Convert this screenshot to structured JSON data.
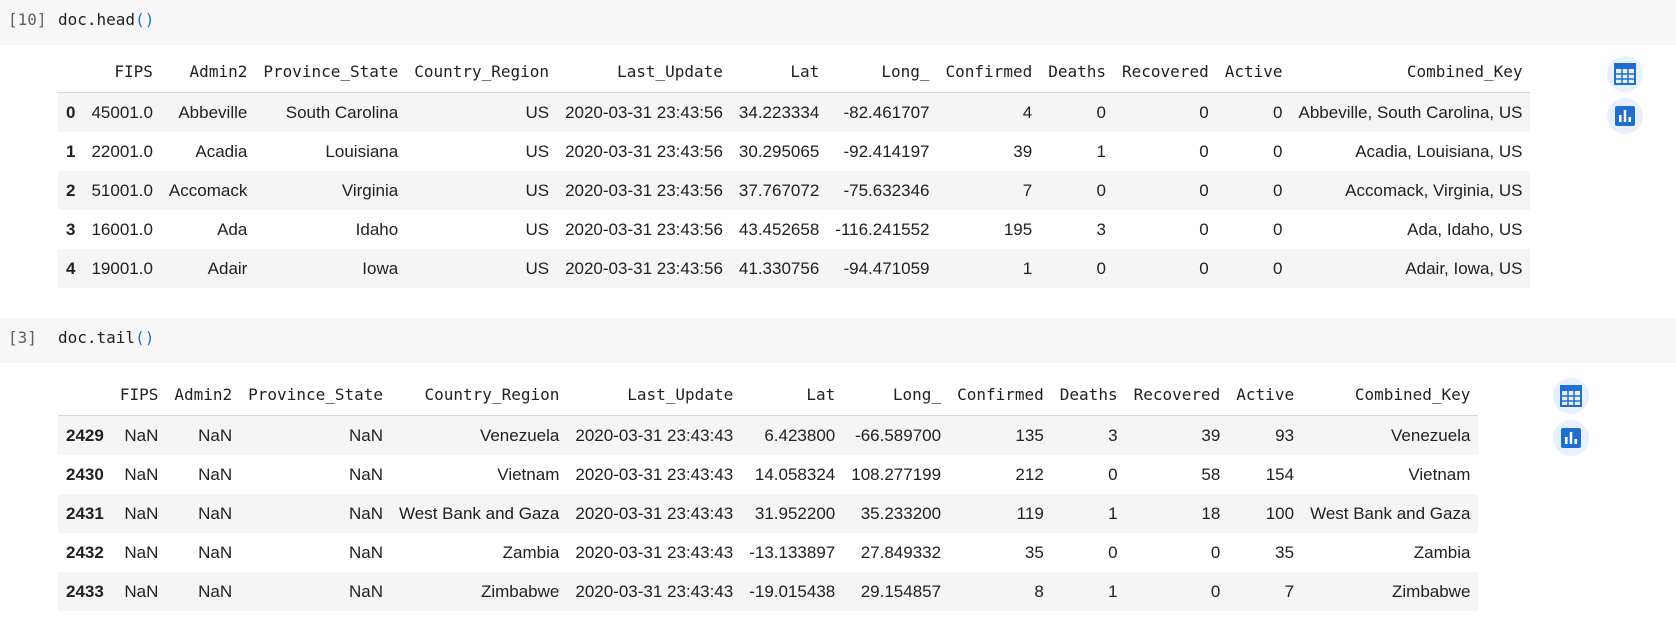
{
  "cells": [
    {
      "prompt": "[10]",
      "code_obj": "doc.head",
      "code_paren": "()",
      "columns": [
        "",
        "FIPS",
        "Admin2",
        "Province_State",
        "Country_Region",
        "Last_Update",
        "Lat",
        "Long_",
        "Confirmed",
        "Deaths",
        "Recovered",
        "Active",
        "Combined_Key"
      ],
      "rows": [
        [
          "0",
          "45001.0",
          "Abbeville",
          "South Carolina",
          "US",
          "2020-03-31 23:43:56",
          "34.223334",
          "-82.461707",
          "4",
          "0",
          "0",
          "0",
          "Abbeville, South Carolina, US"
        ],
        [
          "1",
          "22001.0",
          "Acadia",
          "Louisiana",
          "US",
          "2020-03-31 23:43:56",
          "30.295065",
          "-92.414197",
          "39",
          "1",
          "0",
          "0",
          "Acadia, Louisiana, US"
        ],
        [
          "2",
          "51001.0",
          "Accomack",
          "Virginia",
          "US",
          "2020-03-31 23:43:56",
          "37.767072",
          "-75.632346",
          "7",
          "0",
          "0",
          "0",
          "Accomack, Virginia, US"
        ],
        [
          "3",
          "16001.0",
          "Ada",
          "Idaho",
          "US",
          "2020-03-31 23:43:56",
          "43.452658",
          "-116.241552",
          "195",
          "3",
          "0",
          "0",
          "Ada, Idaho, US"
        ],
        [
          "4",
          "19001.0",
          "Adair",
          "Iowa",
          "US",
          "2020-03-31 23:43:56",
          "41.330756",
          "-94.471059",
          "1",
          "0",
          "0",
          "0",
          "Adair, Iowa, US"
        ]
      ]
    },
    {
      "prompt": "[3]",
      "code_obj": "doc.tail",
      "code_paren": "()",
      "columns": [
        "",
        "FIPS",
        "Admin2",
        "Province_State",
        "Country_Region",
        "Last_Update",
        "Lat",
        "Long_",
        "Confirmed",
        "Deaths",
        "Recovered",
        "Active",
        "Combined_Key"
      ],
      "rows": [
        [
          "2429",
          "NaN",
          "NaN",
          "NaN",
          "Venezuela",
          "2020-03-31 23:43:43",
          "6.423800",
          "-66.589700",
          "135",
          "3",
          "39",
          "93",
          "Venezuela"
        ],
        [
          "2430",
          "NaN",
          "NaN",
          "NaN",
          "Vietnam",
          "2020-03-31 23:43:43",
          "14.058324",
          "108.277199",
          "212",
          "0",
          "58",
          "154",
          "Vietnam"
        ],
        [
          "2431",
          "NaN",
          "NaN",
          "NaN",
          "West Bank and Gaza",
          "2020-03-31 23:43:43",
          "31.952200",
          "35.233200",
          "119",
          "1",
          "18",
          "100",
          "West Bank and Gaza"
        ],
        [
          "2432",
          "NaN",
          "NaN",
          "NaN",
          "Zambia",
          "2020-03-31 23:43:43",
          "-13.133897",
          "27.849332",
          "35",
          "0",
          "0",
          "35",
          "Zambia"
        ],
        [
          "2433",
          "NaN",
          "NaN",
          "NaN",
          "Zimbabwe",
          "2020-03-31 23:43:43",
          "-19.015438",
          "29.154857",
          "8",
          "1",
          "0",
          "7",
          "Zimbabwe"
        ]
      ]
    }
  ],
  "icons": {
    "table": "table-icon",
    "chart": "bar-chart-icon"
  },
  "colors": {
    "accent": "#1f6fd0",
    "button_bg": "#e8f0fe",
    "code_bg": "#f7f7f7"
  }
}
